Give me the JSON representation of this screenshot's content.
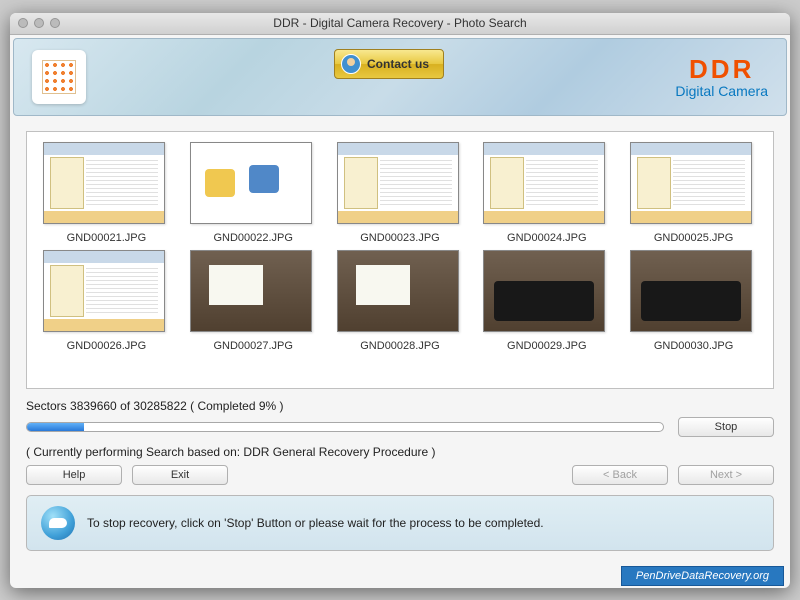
{
  "window": {
    "title": "DDR - Digital Camera Recovery - Photo Search"
  },
  "header": {
    "contact_label": "Contact us",
    "brand_title": "DDR",
    "brand_subtitle": "Digital Camera"
  },
  "thumbnails": {
    "row1": [
      {
        "label": "GND00021.JPG"
      },
      {
        "label": "GND00022.JPG"
      },
      {
        "label": "GND00023.JPG"
      },
      {
        "label": "GND00024.JPG"
      },
      {
        "label": "GND00025.JPG"
      }
    ],
    "row2": [
      {
        "label": "GND00026.JPG"
      },
      {
        "label": "GND00027.JPG"
      },
      {
        "label": "GND00028.JPG"
      },
      {
        "label": "GND00029.JPG"
      },
      {
        "label": "GND00030.JPG"
      }
    ]
  },
  "progress": {
    "text": "Sectors 3839660 of 30285822   ( Completed 9% )",
    "percent": 9,
    "stop_label": "Stop"
  },
  "status": {
    "text": "( Currently performing Search based on: DDR General Recovery Procedure )"
  },
  "nav": {
    "help_label": "Help",
    "exit_label": "Exit",
    "back_label": "< Back",
    "next_label": "Next >"
  },
  "info": {
    "text": "To stop recovery, click on 'Stop' Button or please wait for the process to be completed."
  },
  "watermark": {
    "text": "PenDriveDataRecovery.org"
  }
}
